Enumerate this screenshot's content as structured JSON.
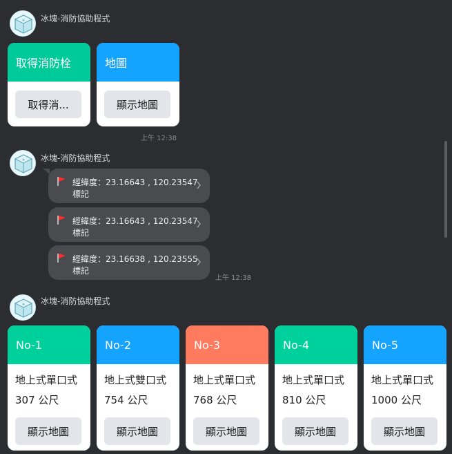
{
  "sender_name": "冰塊-消防協助程式",
  "message1": {
    "cards": [
      {
        "header": "取得消防栓",
        "header_color": "#00c99a",
        "button": "取得消..."
      },
      {
        "header": "地圖",
        "header_color": "#14a3ff",
        "button": "顯示地圖"
      }
    ],
    "time": "上午 12:38"
  },
  "message2": {
    "locations": [
      {
        "coords": "經緯度：23.16643 , 120.23547",
        "label": "標記"
      },
      {
        "coords": "經緯度：23.16643 , 120.23547",
        "label": "標記"
      },
      {
        "coords": "經緯度：23.16638 , 120.23555",
        "label": "標記"
      }
    ],
    "time": "上午 12:38"
  },
  "message3": {
    "cards": [
      {
        "header": "No-1",
        "header_color": "#00d09c",
        "type": "地上式單口式",
        "distance": "307 公尺",
        "button": "顯示地圖"
      },
      {
        "header": "No-2",
        "header_color": "#14a3ff",
        "type": "地上式雙口式",
        "distance": "754 公尺",
        "button": "顯示地圖"
      },
      {
        "header": "No-3",
        "header_color": "#ff7b5f",
        "type": "地上式單口式",
        "distance": "768 公尺",
        "button": "顯示地圖"
      },
      {
        "header": "No-4",
        "header_color": "#00d09c",
        "type": "地上式單口式",
        "distance": "810 公尺",
        "button": "顯示地圖"
      },
      {
        "header": "No-5",
        "header_color": "#14a3ff",
        "type": "地上式單口式",
        "distance": "1000 公尺",
        "button": "顯示地圖"
      }
    ]
  },
  "icons": {
    "avatar": "bot-avatar-icon",
    "flag": "red-flag-icon",
    "chevron": "chevron-right-icon"
  }
}
